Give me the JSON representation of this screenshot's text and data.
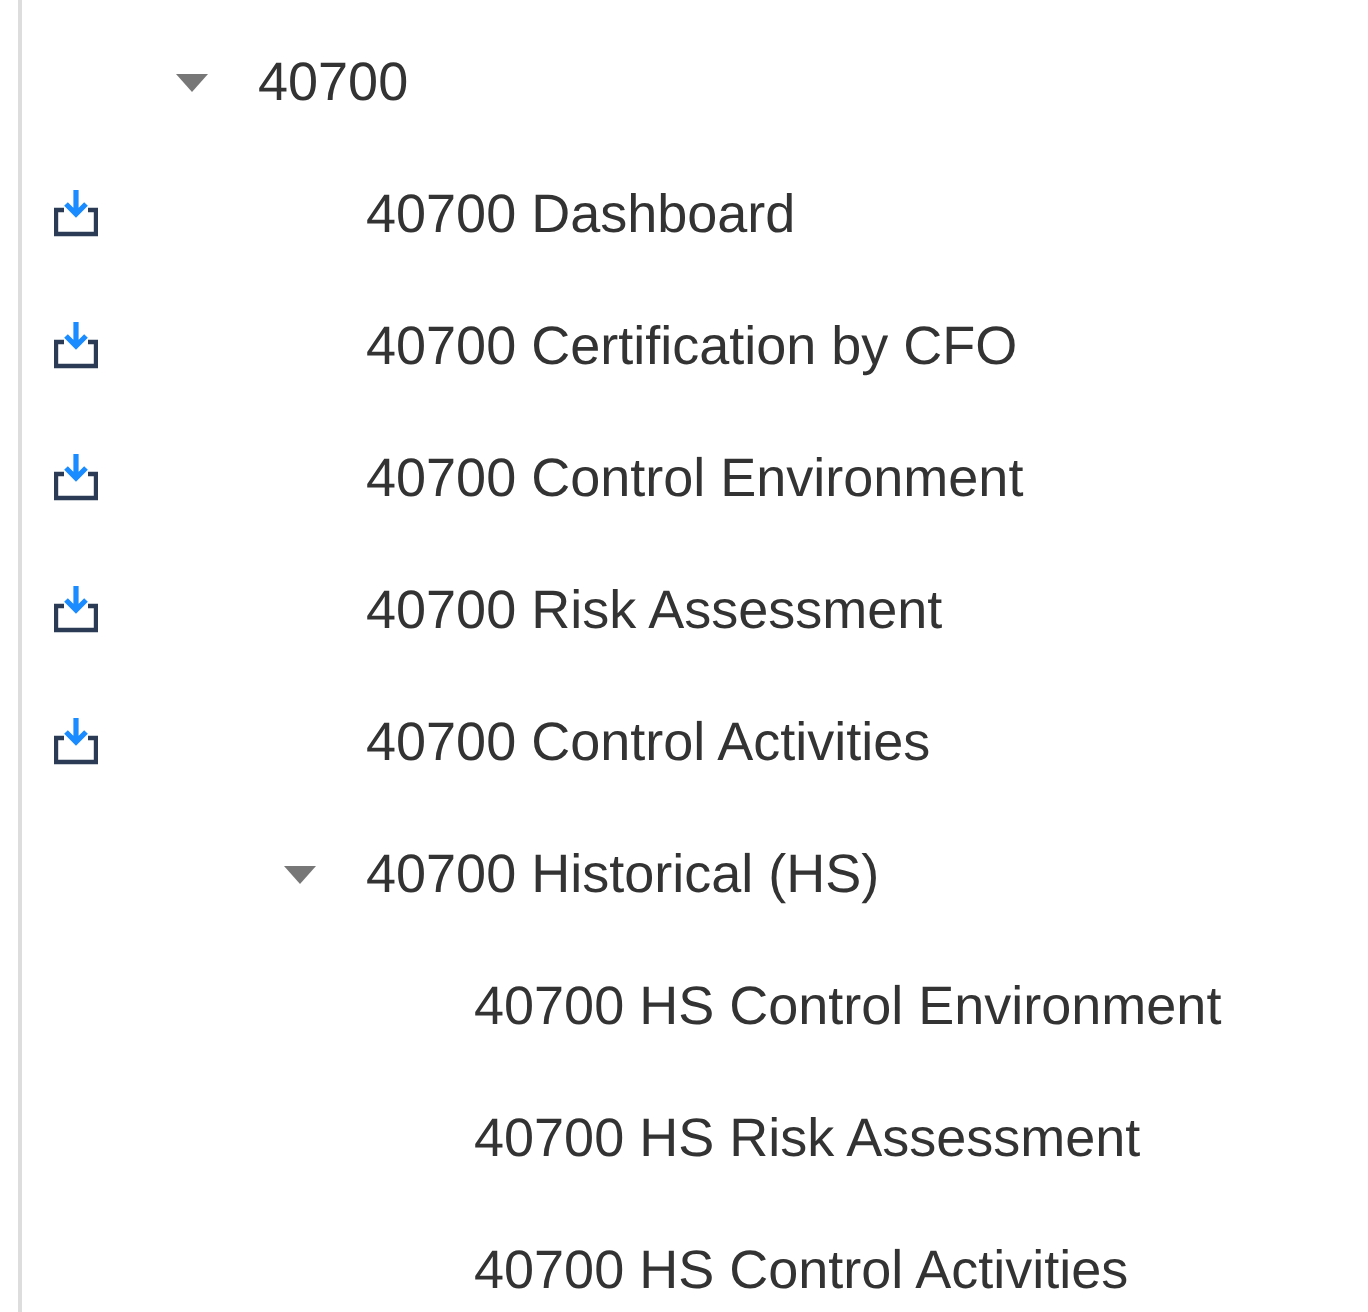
{
  "tree": [
    {
      "label": "40700",
      "kind": "folder",
      "expanded": true,
      "children": [
        {
          "label": "40700 Dashboard",
          "kind": "download-item"
        },
        {
          "label": "40700 Certification by CFO",
          "kind": "download-item"
        },
        {
          "label": "40700 Control Environment",
          "kind": "download-item"
        },
        {
          "label": "40700 Risk Assessment",
          "kind": "download-item"
        },
        {
          "label": "40700 Control Activities",
          "kind": "download-item"
        },
        {
          "label": "40700 Historical (HS)",
          "kind": "folder",
          "expanded": true,
          "children": [
            {
              "label": "40700 HS Control Environment",
              "kind": "item"
            },
            {
              "label": "40700 HS Risk Assessment",
              "kind": "item"
            },
            {
              "label": "40700 HS Control Activities",
              "kind": "item"
            }
          ]
        }
      ]
    }
  ]
}
